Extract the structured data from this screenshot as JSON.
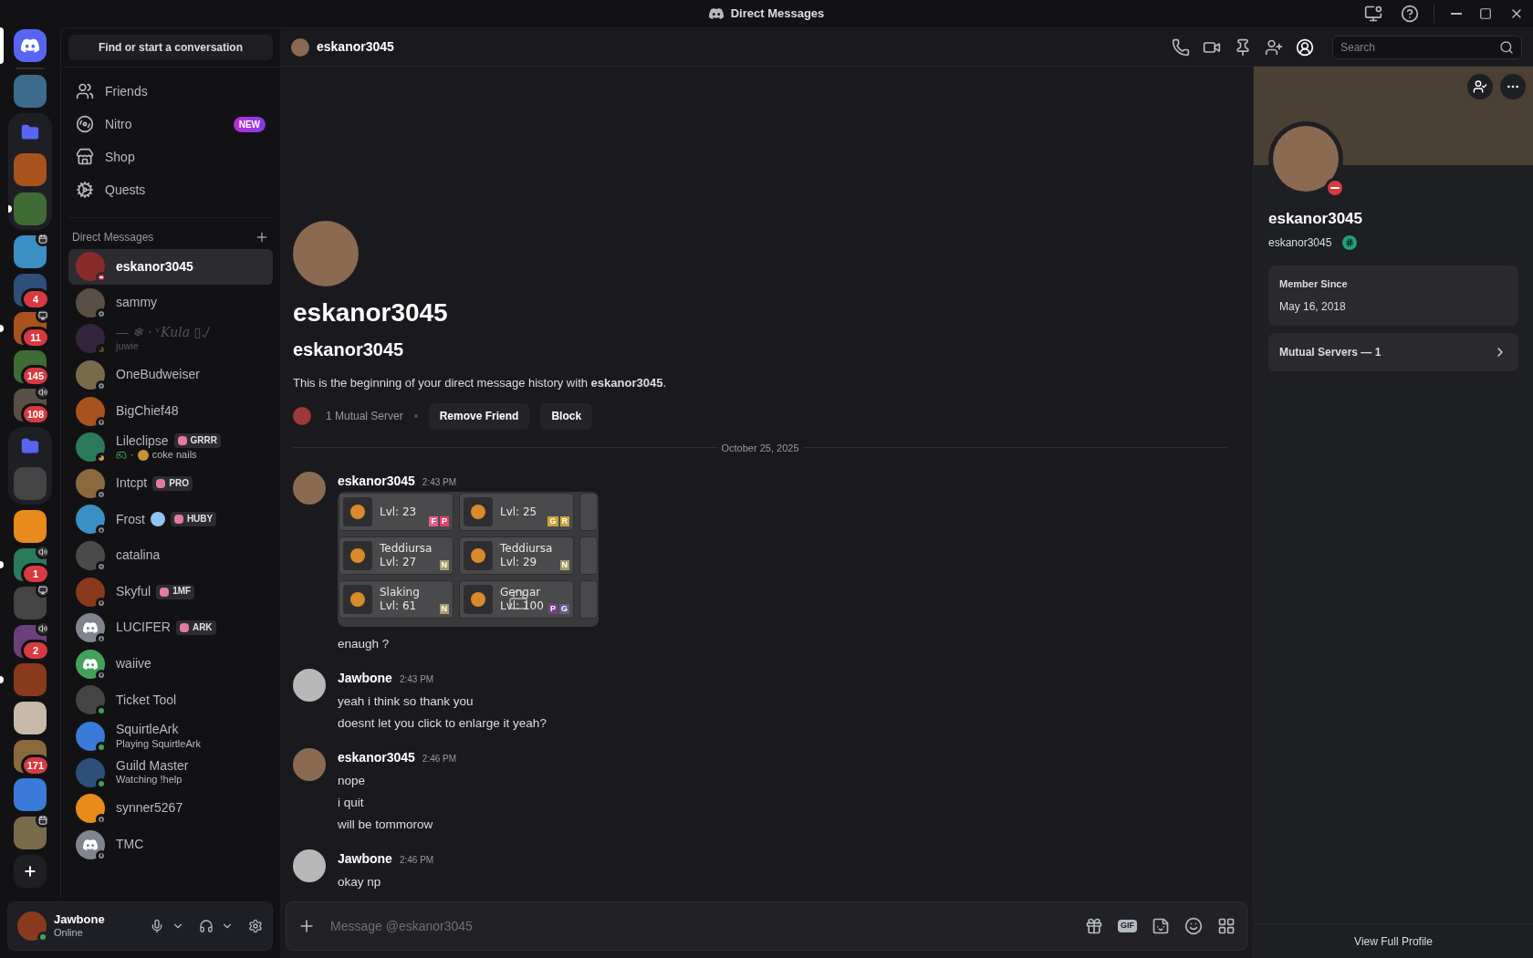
{
  "titlebar": {
    "title": "Direct Messages"
  },
  "rail": [
    {
      "kind": "home",
      "selected": true
    },
    {
      "kind": "server",
      "selected": false,
      "unread": false
    },
    {
      "kind": "folder",
      "children": [
        {
          "kind": "server",
          "selected": false,
          "unread": false
        },
        {
          "kind": "server",
          "selected": false,
          "unread": true
        }
      ]
    },
    {
      "kind": "server",
      "selected": false,
      "unread": false,
      "overlay": {
        "kind": "event"
      }
    },
    {
      "kind": "server",
      "selected": false,
      "unread": false,
      "badge": "4"
    },
    {
      "kind": "server",
      "selected": false,
      "unread": true,
      "overlay": {
        "kind": "stream"
      },
      "badge": "11"
    },
    {
      "kind": "server",
      "selected": false,
      "unread": false,
      "badge": "145"
    },
    {
      "kind": "server",
      "selected": false,
      "unread": false,
      "overlay": {
        "kind": "voice"
      },
      "badge": "108"
    },
    {
      "kind": "folder",
      "children": [
        {
          "kind": "server",
          "selected": false,
          "unread": false
        }
      ]
    },
    {
      "kind": "server",
      "selected": false,
      "unread": false
    },
    {
      "kind": "server",
      "selected": false,
      "unread": true,
      "overlay": {
        "kind": "voice"
      },
      "badge": "1"
    },
    {
      "kind": "server",
      "selected": false,
      "unread": false,
      "overlay": {
        "kind": "stream"
      }
    },
    {
      "kind": "server",
      "selected": false,
      "unread": false,
      "overlay": {
        "kind": "voice"
      },
      "badge": "2"
    },
    {
      "kind": "server",
      "selected": false,
      "unread": true
    },
    {
      "kind": "server",
      "selected": false,
      "unread": false
    },
    {
      "kind": "server",
      "selected": false,
      "unread": false,
      "badge": "171"
    },
    {
      "kind": "server",
      "selected": false,
      "unread": false
    },
    {
      "kind": "server",
      "selected": false,
      "unread": false,
      "overlay": {
        "kind": "event"
      }
    },
    {
      "kind": "add"
    }
  ],
  "sidebar": {
    "search_button": "Find or start a conversation",
    "nav": [
      {
        "label": "Friends",
        "selected": false
      },
      {
        "label": "Nitro",
        "selected": false,
        "badge": "NEW"
      },
      {
        "label": "Shop",
        "selected": false
      },
      {
        "label": "Quests",
        "selected": false
      }
    ],
    "dm_header": "Direct Messages",
    "dms": [
      {
        "name": "eskanor3045",
        "status": {
          "kind": "dnd"
        },
        "selected": true,
        "muted": false
      },
      {
        "name": "sammy",
        "status": {
          "kind": "offline"
        },
        "selected": false,
        "muted": false
      },
      {
        "name": "— ❄ · ᵛKula ▯./",
        "status": {
          "kind": "idle"
        },
        "selected": false,
        "muted": true,
        "subtitle": "juwie"
      },
      {
        "name": "OneBudweiser",
        "status": {
          "kind": "offline"
        },
        "selected": false,
        "muted": false
      },
      {
        "name": "BigChief48",
        "status": {
          "kind": "offline"
        },
        "selected": false,
        "muted": false
      },
      {
        "name": "Lileclipse",
        "status": {
          "kind": "idle"
        },
        "selected": false,
        "muted": false,
        "tag": "GRRR",
        "activity": {
          "separator": "·",
          "text": "coke nails"
        }
      },
      {
        "name": "Intcpt",
        "status": {
          "kind": "offline"
        },
        "selected": false,
        "muted": false,
        "tag": "PRO"
      },
      {
        "name": "Frost",
        "status": {
          "kind": "offline"
        },
        "selected": false,
        "muted": false,
        "name_emoji": true,
        "tag": "HUBY"
      },
      {
        "name": "catalina",
        "status": {
          "kind": "offline"
        },
        "selected": false,
        "muted": false
      },
      {
        "name": "Skyful",
        "status": {
          "kind": "offline"
        },
        "selected": false,
        "muted": false,
        "tag": "1MF"
      },
      {
        "name": "LUCIFER",
        "status": {
          "kind": "offline"
        },
        "selected": false,
        "muted": false,
        "avatar": {
          "kind": "logo"
        },
        "tag": "ARK"
      },
      {
        "name": "waiive",
        "status": {
          "kind": "offline"
        },
        "selected": false,
        "muted": false,
        "avatar": {
          "kind": "logo"
        }
      },
      {
        "name": "Ticket Tool",
        "status": {
          "kind": "online"
        },
        "selected": false,
        "muted": false
      },
      {
        "name": "SquirtleArk",
        "status": {
          "kind": "online"
        },
        "selected": false,
        "muted": false,
        "subtitle": "Playing SquirtleArk"
      },
      {
        "name": "Guild Master",
        "status": {
          "kind": "online"
        },
        "selected": false,
        "muted": false,
        "subtitle": "Watching !help"
      },
      {
        "name": "synner5267",
        "status": {
          "kind": "offline"
        },
        "selected": false,
        "muted": false
      },
      {
        "name": "TMC",
        "status": {
          "kind": "offline"
        },
        "selected": false,
        "muted": false,
        "avatar": {
          "kind": "logo"
        }
      }
    ]
  },
  "user_panel": {
    "name": "Jawbone",
    "status_text": "Online",
    "status": {
      "kind": "online"
    }
  },
  "header": {
    "name": "eskanor3045",
    "search_placeholder": "Search"
  },
  "intro": {
    "display_name": "eskanor3045",
    "username": "eskanor3045",
    "text": "This is the beginning of your direct message history with **eskanor3045**.",
    "mutual": "1 Mutual Server",
    "buttons": [
      "Remove Friend",
      "Block"
    ]
  },
  "date_divider": "October 25, 2025",
  "messages": [
    {
      "author": "eskanor3045",
      "time": "2:43 PM",
      "lines": [
        {
          "kind": "attachment",
          "cells": [
            {
              "lvl": "Lvl: 23",
              "tags": [
                {
                  "label": "F",
                  "color": "#e35d8a"
                },
                {
                  "label": "P",
                  "color": "#e0426e"
                }
              ]
            },
            {
              "lvl": "Lvl: 25",
              "tags": [
                {
                  "label": "G",
                  "color": "#c9a43a"
                },
                {
                  "label": "R",
                  "color": "#c9a43a"
                }
              ]
            },
            {
              "name": "Teddiursa",
              "lvl": "Lvl: 27",
              "tags": [
                {
                  "label": "N",
                  "color": "#a79e6a"
                }
              ]
            },
            {
              "name": "Teddiursa",
              "lvl": "Lvl: 29",
              "tags": [
                {
                  "label": "N",
                  "color": "#a79e6a"
                }
              ]
            },
            {
              "name": "Slaking",
              "lvl": "Lvl: 61",
              "tags": [
                {
                  "label": "N",
                  "color": "#a79e6a"
                }
              ]
            },
            {
              "name": "Gengar",
              "lvl": "Lvl: 100",
              "locked": true,
              "tags": [
                {
                  "label": "P",
                  "color": "#7a3f8c"
                },
                {
                  "label": "G",
                  "color": "#6a5a8a"
                }
              ]
            }
          ]
        },
        {
          "kind": "text",
          "text": "enaugh ?"
        }
      ]
    },
    {
      "author": "Jawbone",
      "time": "2:43 PM",
      "lines": [
        {
          "kind": "text",
          "text": "yeah i think so thank you"
        },
        {
          "kind": "text",
          "text": "doesnt let you click to enlarge it yeah?"
        }
      ]
    },
    {
      "author": "eskanor3045",
      "time": "2:46 PM",
      "lines": [
        {
          "kind": "text",
          "text": "nope"
        },
        {
          "kind": "text",
          "text": "i quit"
        },
        {
          "kind": "text",
          "text": "will be tommorow"
        }
      ]
    },
    {
      "author": "Jawbone",
      "time": "2:46 PM",
      "lines": [
        {
          "kind": "text",
          "text": "okay np"
        }
      ]
    }
  ],
  "composer": {
    "placeholder": "Message @eskanor3045",
    "gif_label": "GIF"
  },
  "profile": {
    "display_name": "eskanor3045",
    "username": "eskanor3045",
    "status": {
      "kind": "dnd"
    },
    "member_since_label": "Member Since",
    "member_since": "May 16, 2018",
    "mutual_servers": "Mutual Servers — 1",
    "footer": "View Full Profile"
  }
}
